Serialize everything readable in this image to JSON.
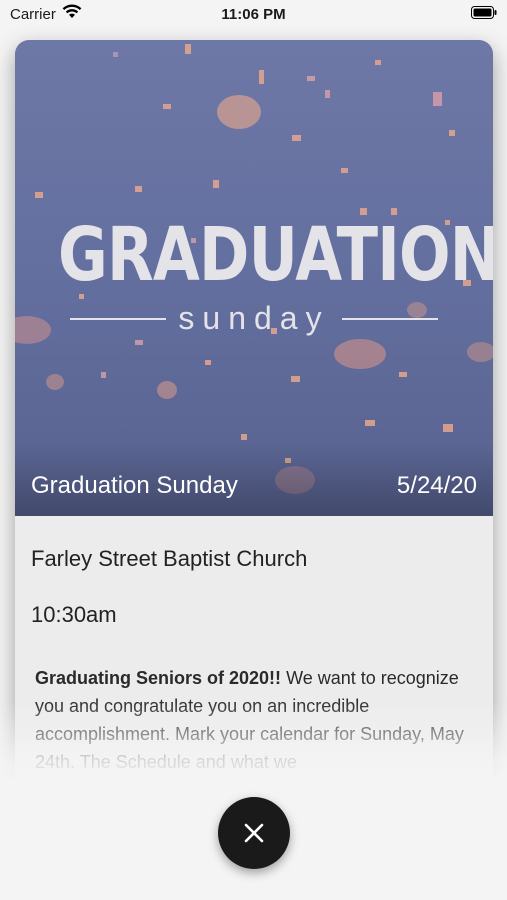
{
  "status_bar": {
    "carrier": "Carrier",
    "time": "11:06 PM"
  },
  "hero": {
    "title": "GRADUATION",
    "subtitle": "sunday",
    "event_name": "Graduation Sunday",
    "date": "5/24/20"
  },
  "details": {
    "church": "Farley Street Baptist Church",
    "time": "10:30am",
    "description_bold": "Graduating Seniors of 2020!!",
    "description_rest": " We want to recognize you and congratulate you on an incredible accomplishment. Mark your calendar for Sunday, May 24th. The Schedule and what we"
  },
  "icons": {
    "wifi": "wifi-icon",
    "battery": "battery-icon",
    "close": "close-icon"
  }
}
